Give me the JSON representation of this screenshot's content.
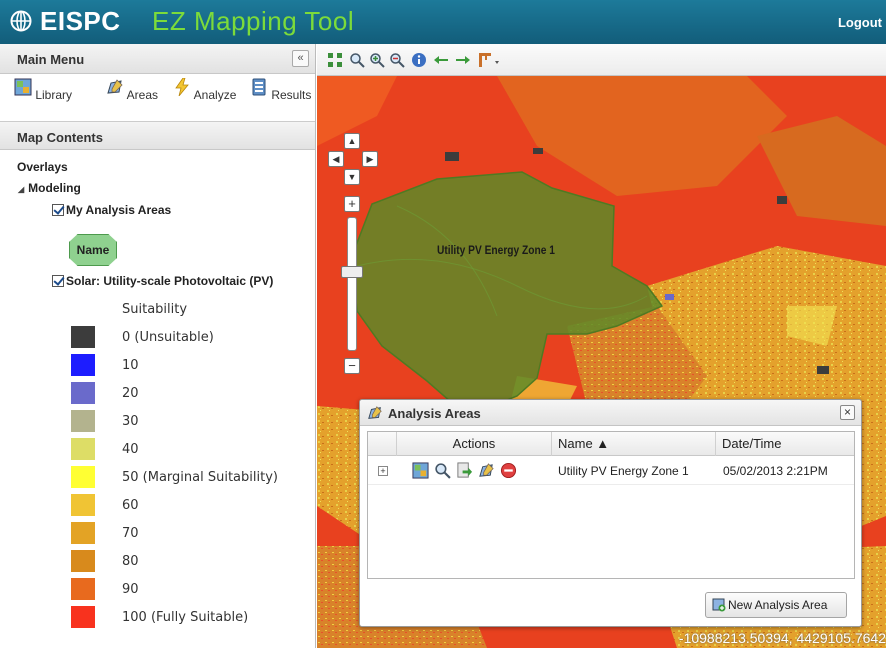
{
  "header": {
    "title_part1": "EISPC",
    "title_part2": "EZ Mapping Tool",
    "logout": "Logout"
  },
  "main_menu": {
    "title": "Main Menu",
    "collapse": "«",
    "items": [
      {
        "label": "Library",
        "icon": "library-icon"
      },
      {
        "label": "Areas",
        "icon": "areas-icon"
      },
      {
        "label": "Analyze",
        "icon": "analyze-icon"
      },
      {
        "label": "Results",
        "icon": "results-icon"
      }
    ]
  },
  "map_contents": {
    "title": "Map Contents",
    "overlays": "Overlays",
    "modeling": "Modeling",
    "my_analysis_areas": "My Analysis Areas",
    "name_swatch": "Name",
    "solar_layer": "Solar: Utility-scale Photovoltaic (PV)",
    "legend_title": "Suitability",
    "legend": [
      {
        "label": "0 (Unsuitable)",
        "color": "#3c3c3c"
      },
      {
        "label": "10",
        "color": "#1d1dff"
      },
      {
        "label": "20",
        "color": "#6a6acb"
      },
      {
        "label": "30",
        "color": "#b3b38e"
      },
      {
        "label": "40",
        "color": "#dddd66"
      },
      {
        "label": "50 (Marginal Suitability)",
        "color": "#ffff33"
      },
      {
        "label": "60",
        "color": "#f0c434"
      },
      {
        "label": "70",
        "color": "#e3a325"
      },
      {
        "label": "80",
        "color": "#d88a1c"
      },
      {
        "label": "90",
        "color": "#e86a1e"
      },
      {
        "label": "100 (Fully Suitable)",
        "color": "#f8321e"
      }
    ]
  },
  "map": {
    "zone_label": "Utility PV Energy Zone 1",
    "coordinates": "-10988213.50394, 4429105.7642",
    "zoom_in": "+",
    "zoom_out": "−"
  },
  "dialog": {
    "title": "Analysis Areas",
    "close": "×",
    "columns": {
      "actions": "Actions",
      "name": "Name ▲",
      "datetime": "Date/Time"
    },
    "rows": [
      {
        "expand": "+",
        "name": "Utility PV Energy Zone 1",
        "datetime": "05/02/2013 2:21PM"
      }
    ],
    "new_button": "New Analysis Area"
  }
}
